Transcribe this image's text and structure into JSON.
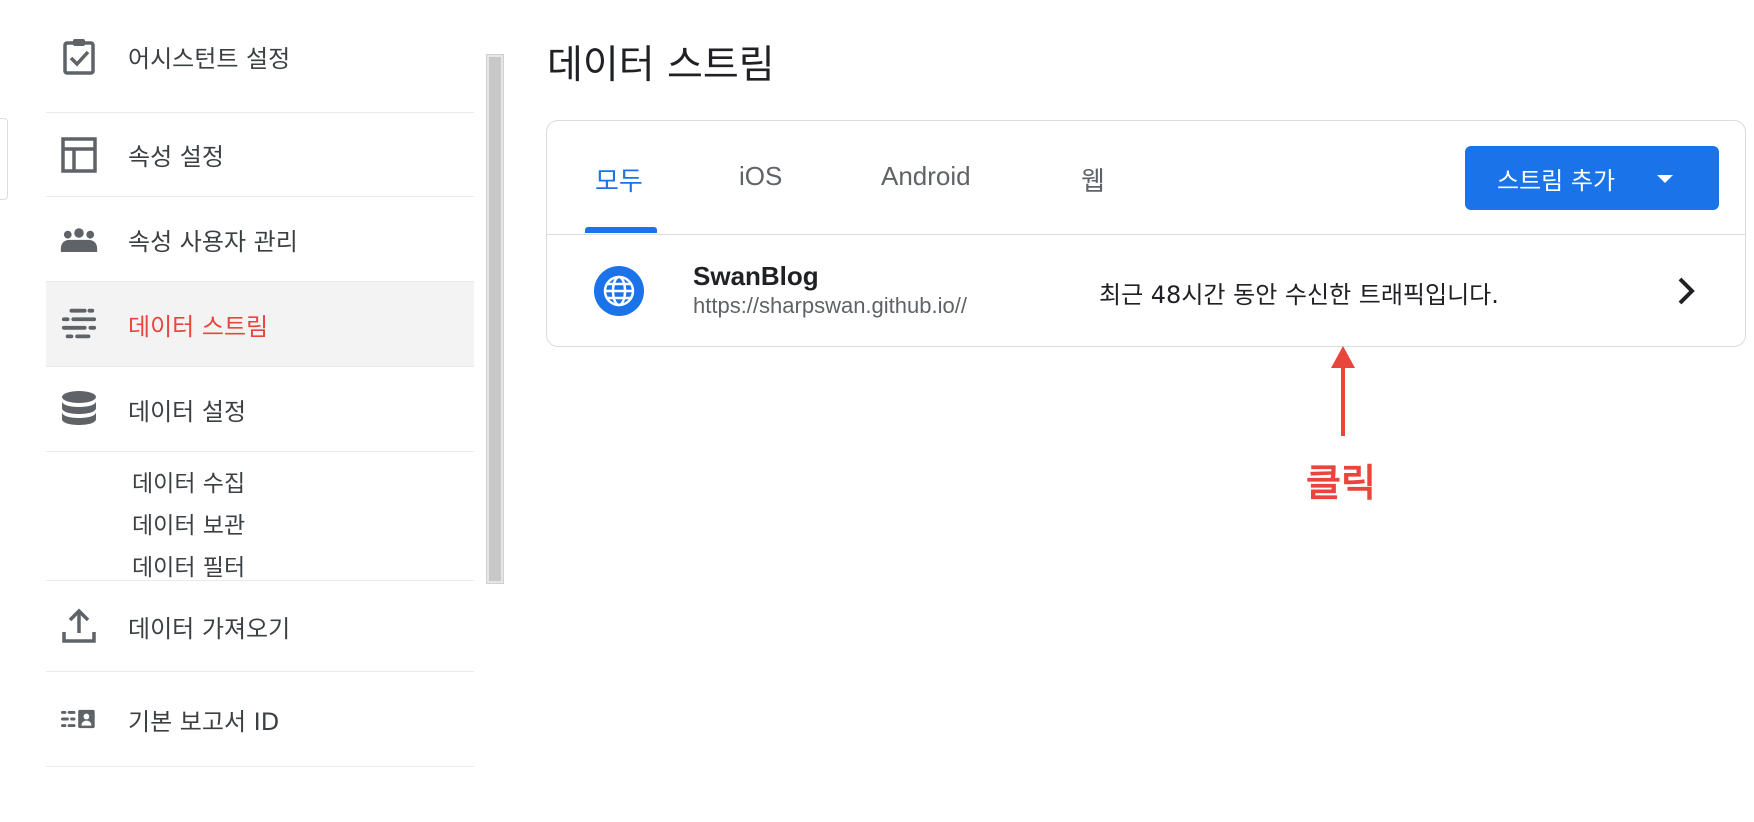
{
  "sidebar": {
    "items": [
      {
        "label": "어시스턴트 설정",
        "icon": "clipboard-check-icon"
      },
      {
        "label": "속성 설정",
        "icon": "layout-icon"
      },
      {
        "label": "속성 사용자 관리",
        "icon": "people-icon"
      },
      {
        "label": "데이터 스트림",
        "icon": "data-streams-icon",
        "active": true
      },
      {
        "label": "데이터 설정",
        "icon": "database-icon"
      },
      {
        "label": "데이터 가져오기",
        "icon": "upload-icon"
      },
      {
        "label": "기본 보고서 ID",
        "icon": "report-id-icon"
      }
    ],
    "sub_items": [
      "데이터 수집",
      "데이터 보관",
      "데이터 필터"
    ]
  },
  "main": {
    "title": "데이터 스트림",
    "tabs": [
      {
        "label": "모두",
        "active": true
      },
      {
        "label": "iOS"
      },
      {
        "label": "Android"
      },
      {
        "label": "웹"
      }
    ],
    "add_button_label": "스트림 추가",
    "stream": {
      "name": "SwanBlog",
      "url": "https://sharpswan.github.io//",
      "note": "최근 48시간 동안 수신한 트래픽입니다."
    }
  },
  "annotation": {
    "label": "클릭"
  },
  "colors": {
    "accent": "#1a73e8",
    "active_nav": "#e8453c",
    "annotation": "#e8453c"
  }
}
